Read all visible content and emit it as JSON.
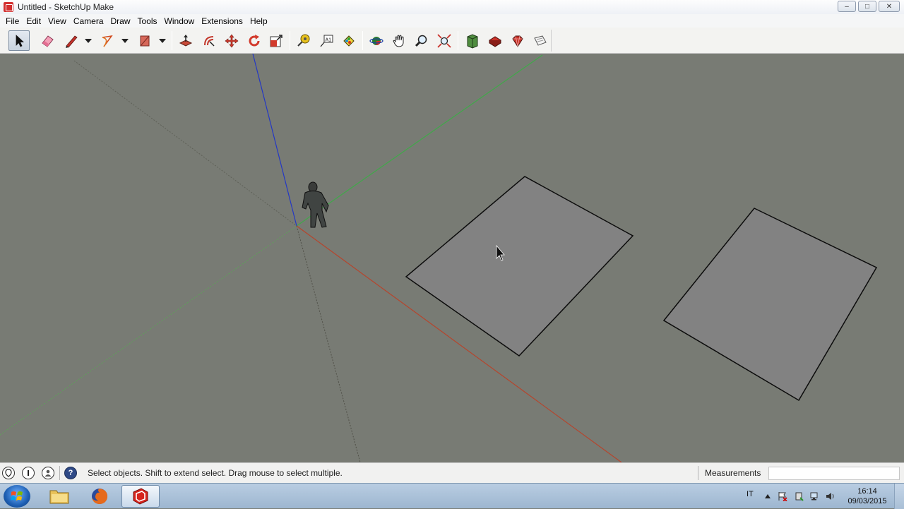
{
  "window": {
    "title": "Untitled - SketchUp Make",
    "minimize_label": "–",
    "maximize_label": "□",
    "close_label": "✕"
  },
  "menu": {
    "items": [
      "File",
      "Edit",
      "View",
      "Camera",
      "Draw",
      "Tools",
      "Window",
      "Extensions",
      "Help"
    ]
  },
  "toolbar": {
    "tools": [
      "select-tool",
      "eraser-tool",
      "line-tool",
      "arc-tool",
      "shapes-tool",
      "push-pull-tool",
      "offset-tool",
      "move-tool",
      "rotate-tool",
      "scale-tool",
      "tape-measure-tool",
      "text-tool",
      "paint-bucket-tool",
      "orbit-tool",
      "pan-tool",
      "zoom-tool",
      "zoom-extents-tool",
      "3d-warehouse-tool",
      "extension-warehouse-tool",
      "sketchup-ruby-tool",
      "layout-tool"
    ],
    "active_tool": "select-tool"
  },
  "colors": {
    "viewport_bg": "#787b74",
    "face_fill": "#808080",
    "red_axis": "#b5452d",
    "green_axis": "#3fa64a",
    "blue_axis": "#2438c4"
  },
  "statusbar": {
    "hint": "Select objects. Shift to extend select. Drag mouse to select multiple.",
    "measurements_label": "Measurements",
    "measurements_value": "",
    "help_icon_text": "?"
  },
  "taskbar": {
    "language": "IT",
    "time": "16:14",
    "date": "09/03/2015",
    "apps": [
      "file-explorer",
      "firefox",
      "sketchup"
    ],
    "active_app": "sketchup"
  }
}
